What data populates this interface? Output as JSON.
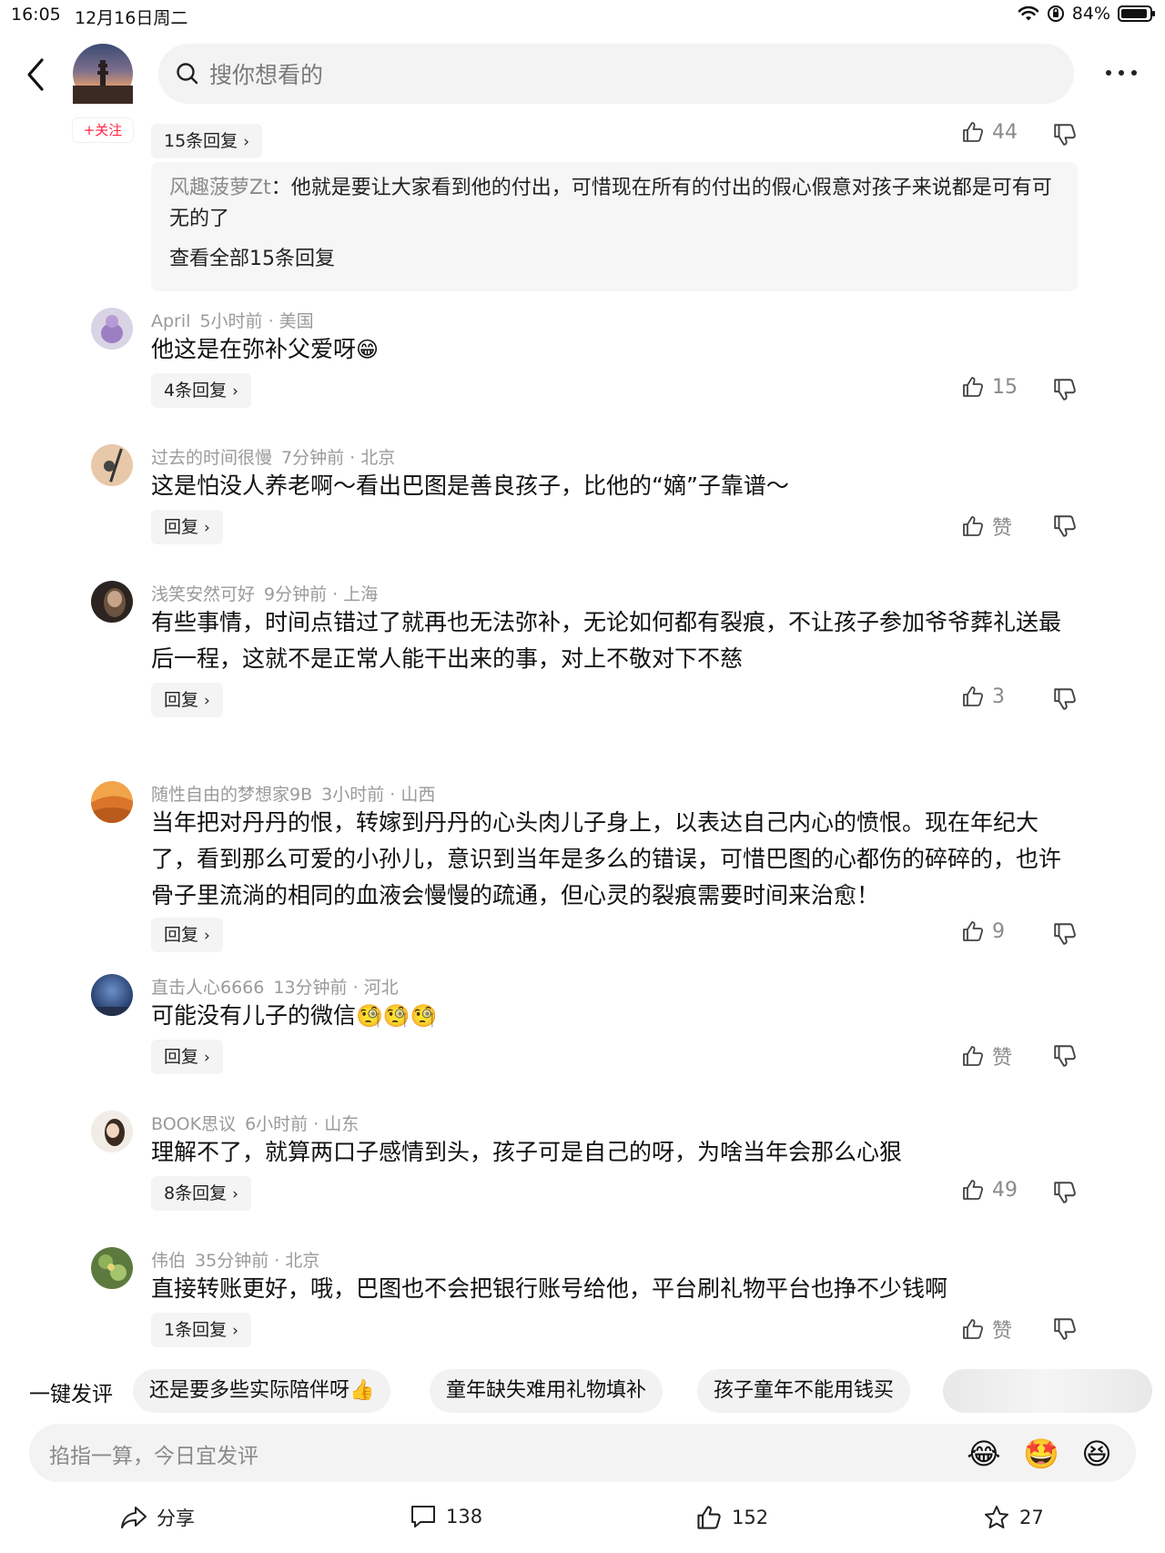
{
  "status_bar": {
    "time": "16:05",
    "date": "12月16日周二",
    "battery": "84%",
    "battery_level": 0.84
  },
  "header": {
    "follow_label": "+关注",
    "search_placeholder": "搜你想看的"
  },
  "top_comment": {
    "reply_count_label": "15条回复",
    "likes": "44",
    "sub_reply_author": "风趣菠萝Zt",
    "sub_reply_sep": "：",
    "sub_reply_text": "他就是要让大家看到他的付出，可惜现在所有的付出的假心假意对孩子来说都是可有可无的了",
    "view_all_label": "查看全部15条回复"
  },
  "comments": [
    {
      "author": "April",
      "time": "5小时前 · 美国",
      "text": "他这是在弥补父爱呀",
      "emoji": "😁",
      "reply_label": "4条回复",
      "likes": "15"
    },
    {
      "author": "过去的时间很慢",
      "time": "7分钟前 · 北京",
      "text": "这是怕没人养老啊～看出巴图是善良孩子，比他的“嫡”子靠谱～",
      "reply_label": "回复",
      "likes": "赞"
    },
    {
      "author": "浅笑安然可好",
      "time": "9分钟前 · 上海",
      "text": "有些事情，时间点错过了就再也无法弥补，无论如何都有裂痕，不让孩子参加爷爷葬礼送最后一程，这就不是正常人能干出来的事，对上不敬对下不慈",
      "reply_label": "回复",
      "likes": "3"
    },
    {
      "author": "随性自由的梦想家9B",
      "time": "3小时前 · 山西",
      "text": "当年把对丹丹的恨，转嫁到丹丹的心头肉儿子身上，以表达自己内心的愤恨。现在年纪大了，看到那么可爱的小孙儿，意识到当年是多么的错误，可惜巴图的心都伤的碎碎的，也许骨子里流淌的相同的血液会慢慢的疏通，但心灵的裂痕需要时间来治愈！",
      "reply_label": "回复",
      "likes": "9"
    },
    {
      "author": "直击人心6666",
      "time": "13分钟前 · 河北",
      "text": "可能没有儿子的微信",
      "emoji": "🧐🧐🧐",
      "reply_label": "回复",
      "likes": "赞"
    },
    {
      "author": "BOOK思议",
      "time": "6小时前 · 山东",
      "text": "理解不了，就算两口子感情到头，孩子可是自己的呀，为啥当年会那么心狠",
      "reply_label": "8条回复",
      "likes": "49"
    },
    {
      "author": "伟伯",
      "time": "35分钟前 · 北京",
      "text": "直接转账更好，哦，巴图也不会把银行账号给他，平台刷礼物平台也挣不少钱啊",
      "reply_label": "1条回复",
      "likes": "赞"
    }
  ],
  "quick_comments": {
    "label": "一键发评",
    "chips": [
      "还是要多些实际陪伴呀👍",
      "童年缺失难用礼物填补",
      "孩子童年不能用钱买"
    ]
  },
  "comment_input": {
    "placeholder": "掐指一算，今日宜发评",
    "emojis": [
      "😂",
      "🤩",
      "😆"
    ]
  },
  "bottom_bar": {
    "share_label": "分享",
    "comments_count": "138",
    "likes_count": "152",
    "favorites_count": "27"
  },
  "colors": {
    "accent_red": "#ff2442",
    "meta_gray": "#9a9a9a",
    "pill_bg": "#f4f4f4"
  }
}
